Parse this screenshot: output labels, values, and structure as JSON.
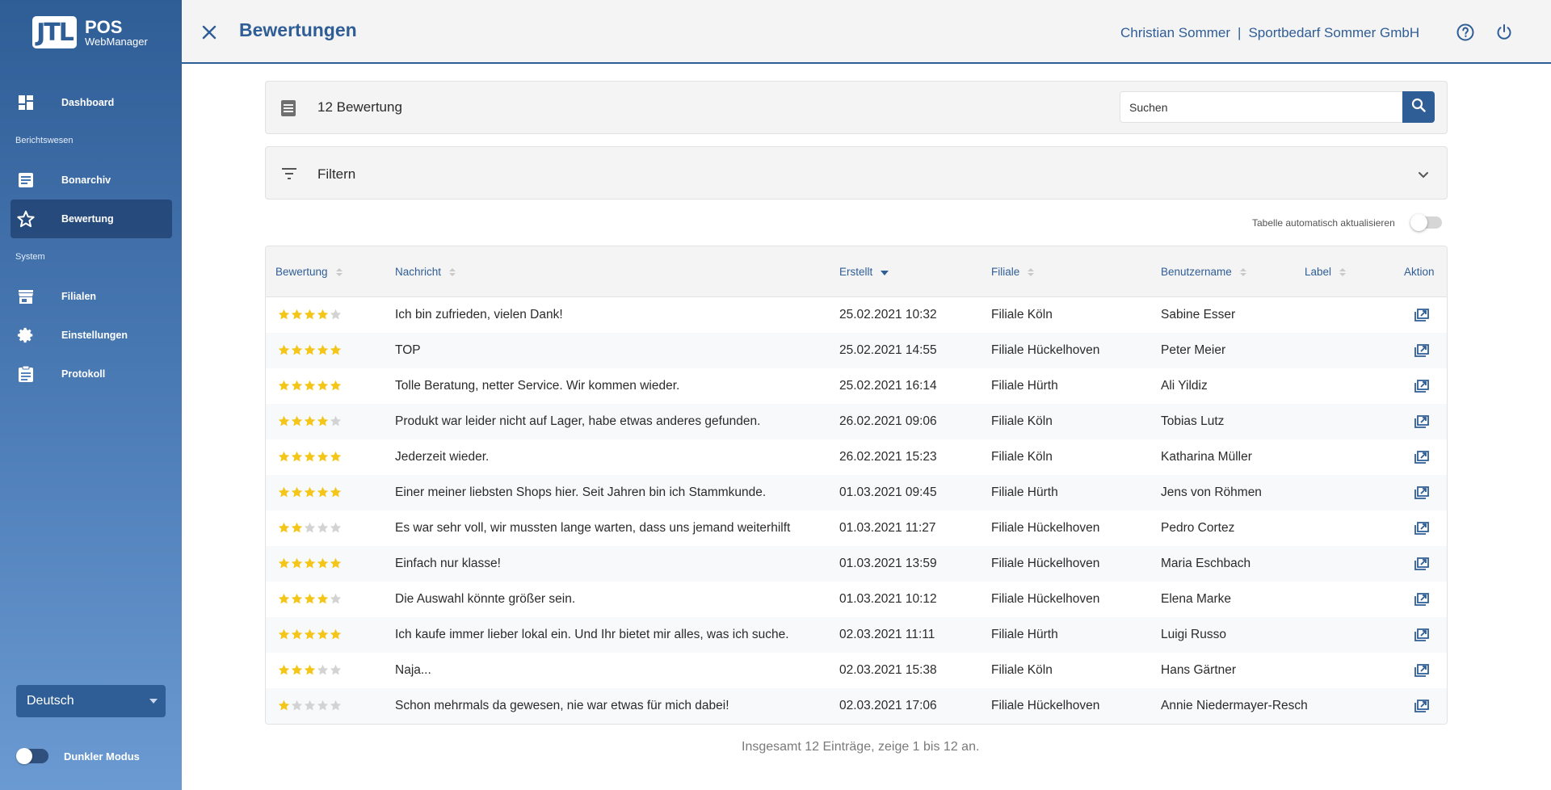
{
  "app": {
    "logo_mark": "JTL",
    "logo_title": "POS",
    "logo_subtitle": "WebManager"
  },
  "sidebar": {
    "dashboard": "Dashboard",
    "section_reporting": "Berichtswesen",
    "bonarchiv": "Bonarchiv",
    "bewertung": "Bewertung",
    "section_system": "System",
    "filialen": "Filialen",
    "einstellungen": "Einstellungen",
    "protokoll": "Protokoll",
    "language": "Deutsch",
    "dark_mode_label": "Dunkler Modus",
    "dark_mode_on": false
  },
  "header": {
    "title": "Bewertungen",
    "user_name": "Christian Sommer",
    "separator": "|",
    "company": "Sportbedarf Sommer GmbH"
  },
  "toolbar": {
    "count_label": "12 Bewertung",
    "search_placeholder": "Suchen",
    "filter_label": "Filtern",
    "auto_refresh_label": "Tabelle automatisch aktualisieren",
    "auto_refresh_on": false
  },
  "table": {
    "columns": {
      "rating": "Bewertung",
      "message": "Nachricht",
      "created": "Erstellt",
      "branch": "Filiale",
      "username": "Benutzername",
      "label": "Label",
      "action": "Aktion"
    },
    "sorted_by": "Erstellt",
    "sort_direction": "desc",
    "rows": [
      {
        "rating": 4,
        "message": "Ich bin zufrieden, vielen Dank!",
        "created": "25.02.2021 10:32",
        "branch": "Filiale Köln",
        "username": "Sabine Esser",
        "label": ""
      },
      {
        "rating": 5,
        "message": "TOP",
        "created": "25.02.2021 14:55",
        "branch": "Filiale Hückelhoven",
        "username": "Peter Meier",
        "label": ""
      },
      {
        "rating": 5,
        "message": "Tolle Beratung, netter Service. Wir kommen wieder.",
        "created": "25.02.2021 16:14",
        "branch": "Filiale Hürth",
        "username": "Ali Yildiz",
        "label": ""
      },
      {
        "rating": 4,
        "message": "Produkt war leider nicht auf Lager, habe etwas anderes gefunden.",
        "created": "26.02.2021 09:06",
        "branch": "Filiale Köln",
        "username": "Tobias Lutz",
        "label": ""
      },
      {
        "rating": 5,
        "message": "Jederzeit wieder.",
        "created": "26.02.2021 15:23",
        "branch": "Filiale Köln",
        "username": "Katharina Müller",
        "label": ""
      },
      {
        "rating": 5,
        "message": "Einer meiner liebsten Shops hier. Seit Jahren bin ich Stammkunde.",
        "created": "01.03.2021 09:45",
        "branch": "Filiale Hürth",
        "username": "Jens von Röhmen",
        "label": ""
      },
      {
        "rating": 2,
        "message": "Es war sehr voll, wir mussten lange warten, dass uns jemand weiterhilft",
        "created": "01.03.2021 11:27",
        "branch": "Filiale Hückelhoven",
        "username": "Pedro Cortez",
        "label": ""
      },
      {
        "rating": 5,
        "message": "Einfach nur klasse!",
        "created": "01.03.2021 13:59",
        "branch": "Filiale Hückelhoven",
        "username": "Maria Eschbach",
        "label": ""
      },
      {
        "rating": 4,
        "message": "Die Auswahl könnte größer sein.",
        "created": "01.03.2021 10:12",
        "branch": "Filiale Hückelhoven",
        "username": "Elena Marke",
        "label": ""
      },
      {
        "rating": 5,
        "message": "Ich kaufe immer lieber lokal ein. Und Ihr bietet mir alles, was ich suche.",
        "created": "02.03.2021 11:11",
        "branch": "Filiale Hürth",
        "username": "Luigi Russo",
        "label": ""
      },
      {
        "rating": 3,
        "message": "Naja...",
        "created": "02.03.2021 15:38",
        "branch": "Filiale Köln",
        "username": "Hans Gärtner",
        "label": ""
      },
      {
        "rating": 1,
        "message": "Schon mehrmals da gewesen, nie war etwas für mich dabei!",
        "created": "02.03.2021 17:06",
        "branch": "Filiale Hückelhoven",
        "username": "Annie Niedermayer-Resch",
        "label": ""
      }
    ],
    "max_rating": 5,
    "footer": "Insgesamt 12 Einträge, zeige 1 bis 12 an."
  },
  "colors": {
    "primary": "#2f5d96",
    "star_filled": "#f5c518",
    "star_empty": "#d3d3d3"
  }
}
